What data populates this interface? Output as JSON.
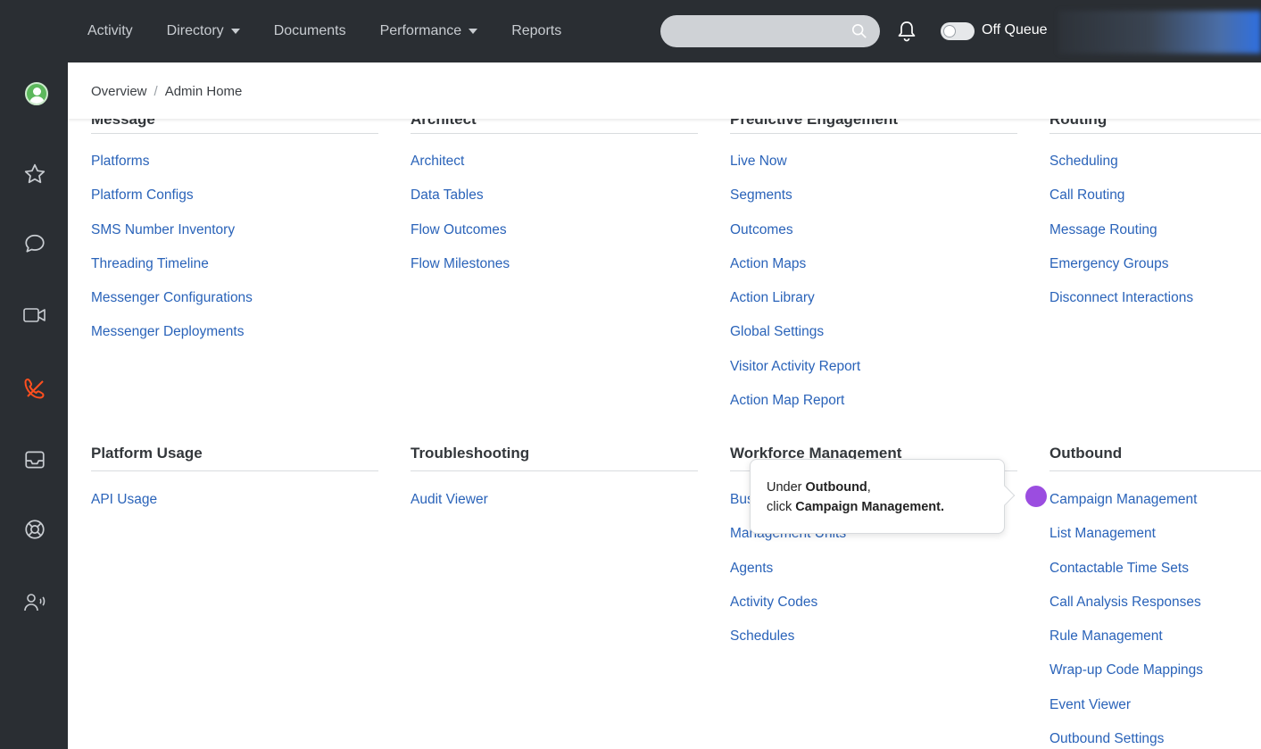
{
  "topnav": {
    "items": [
      {
        "label": "Activity",
        "caret": false
      },
      {
        "label": "Directory",
        "caret": true
      },
      {
        "label": "Documents",
        "caret": false
      },
      {
        "label": "Performance",
        "caret": true
      },
      {
        "label": "Reports",
        "caret": false
      }
    ],
    "search": {
      "value": "",
      "placeholder": ""
    },
    "queue_toggle_label": "Off Queue",
    "queue_on": false
  },
  "sidebar": {
    "icons": [
      "avatar",
      "star-icon",
      "chat-icon",
      "video-icon",
      "phone-icon",
      "inbox-icon",
      "lifebuoy-icon",
      "person-voice-icon"
    ],
    "active": "phone-icon",
    "accent": "#ff4f1f"
  },
  "breadcrumb": {
    "root": "Overview",
    "current": "Admin Home"
  },
  "sections_top": [
    {
      "title": "Message",
      "links": [
        "Platforms",
        "Platform Configs",
        "SMS Number Inventory",
        "Threading Timeline",
        "Messenger Configurations",
        "Messenger Deployments"
      ]
    },
    {
      "title": "Architect",
      "links": [
        "Architect",
        "Data Tables",
        "Flow Outcomes",
        "Flow Milestones"
      ]
    },
    {
      "title": "Predictive Engagement",
      "links": [
        "Live Now",
        "Segments",
        "Outcomes",
        "Action Maps",
        "Action Library",
        "Global Settings",
        "Visitor Activity Report",
        "Action Map Report"
      ]
    },
    {
      "title": "Routing",
      "links": [
        "Scheduling",
        "Call Routing",
        "Message Routing",
        "Emergency Groups",
        "Disconnect Interactions"
      ]
    }
  ],
  "sections_bottom": [
    {
      "title": "Platform Usage",
      "links": [
        "API Usage"
      ]
    },
    {
      "title": "Troubleshooting",
      "links": [
        "Audit Viewer"
      ]
    },
    {
      "title": "Workforce Management",
      "links": [
        "Business Units",
        "Management Units",
        "Agents",
        "Activity Codes",
        "Schedules"
      ]
    },
    {
      "title": "Outbound",
      "links": [
        "Campaign Management",
        "List Management",
        "Contactable Time Sets",
        "Call Analysis Responses",
        "Rule Management",
        "Wrap-up Code Mappings",
        "Event Viewer",
        "Outbound Settings"
      ]
    }
  ],
  "callout": {
    "line1_prefix": "Under ",
    "line1_bold": "Outbound",
    "line1_suffix": ",",
    "line2_prefix": "click ",
    "line2_bold": "Campaign Management."
  },
  "colors": {
    "nav_bg": "#2a2e33",
    "link": "#2a63b9",
    "highlight_dot": "#9b4de0",
    "brand": "#ff4f1f"
  }
}
